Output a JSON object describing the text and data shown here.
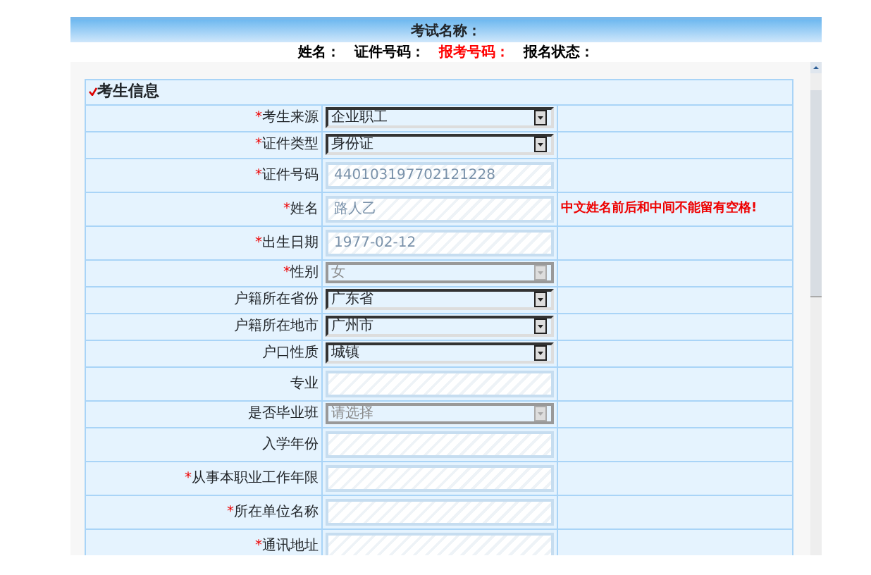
{
  "header": {
    "title": "考试名称："
  },
  "summary": [
    {
      "label": "姓名：",
      "color": "#000000"
    },
    {
      "label": "证件号码：",
      "color": "#000000"
    },
    {
      "label": "报考号码：",
      "color": "#ff0000"
    },
    {
      "label": "报名状态：",
      "color": "#000000"
    }
  ],
  "section": {
    "title": "考生信息"
  },
  "fields": [
    {
      "kind": "select",
      "mark": "*",
      "label": "考生来源",
      "value": "企业职工",
      "disabled": false
    },
    {
      "kind": "select",
      "mark": "*",
      "label": "证件类型",
      "value": "身份证",
      "disabled": false
    },
    {
      "kind": "input",
      "mark": "*",
      "label": "证件号码",
      "value": "440103197702121228"
    },
    {
      "kind": "input",
      "mark": "*",
      "label": "姓名",
      "value": "路人乙",
      "hint": "中文姓名前后和中间不能留有空格!"
    },
    {
      "kind": "input",
      "mark": "*",
      "label": "出生日期",
      "value": "1977-02-12"
    },
    {
      "kind": "select",
      "mark": "*",
      "label": "性别",
      "value": "女",
      "disabled": true
    },
    {
      "kind": "select",
      "label": "户籍所在省份",
      "value": "广东省",
      "disabled": false
    },
    {
      "kind": "select",
      "label": "户籍所在地市",
      "value": "广州市",
      "disabled": false
    },
    {
      "kind": "select",
      "label": "户口性质",
      "value": "城镇",
      "disabled": false
    },
    {
      "kind": "input",
      "label": "专业"
    },
    {
      "kind": "select",
      "label": "是否毕业班",
      "value": "请选择",
      "disabled": true
    },
    {
      "kind": "input",
      "label": "入学年份"
    },
    {
      "kind": "input",
      "mark": "*",
      "label": "从事本职业工作年限"
    },
    {
      "kind": "input",
      "mark": "*",
      "label": "所在单位名称"
    },
    {
      "kind": "input",
      "mark": "*",
      "label": "通讯地址"
    }
  ]
}
